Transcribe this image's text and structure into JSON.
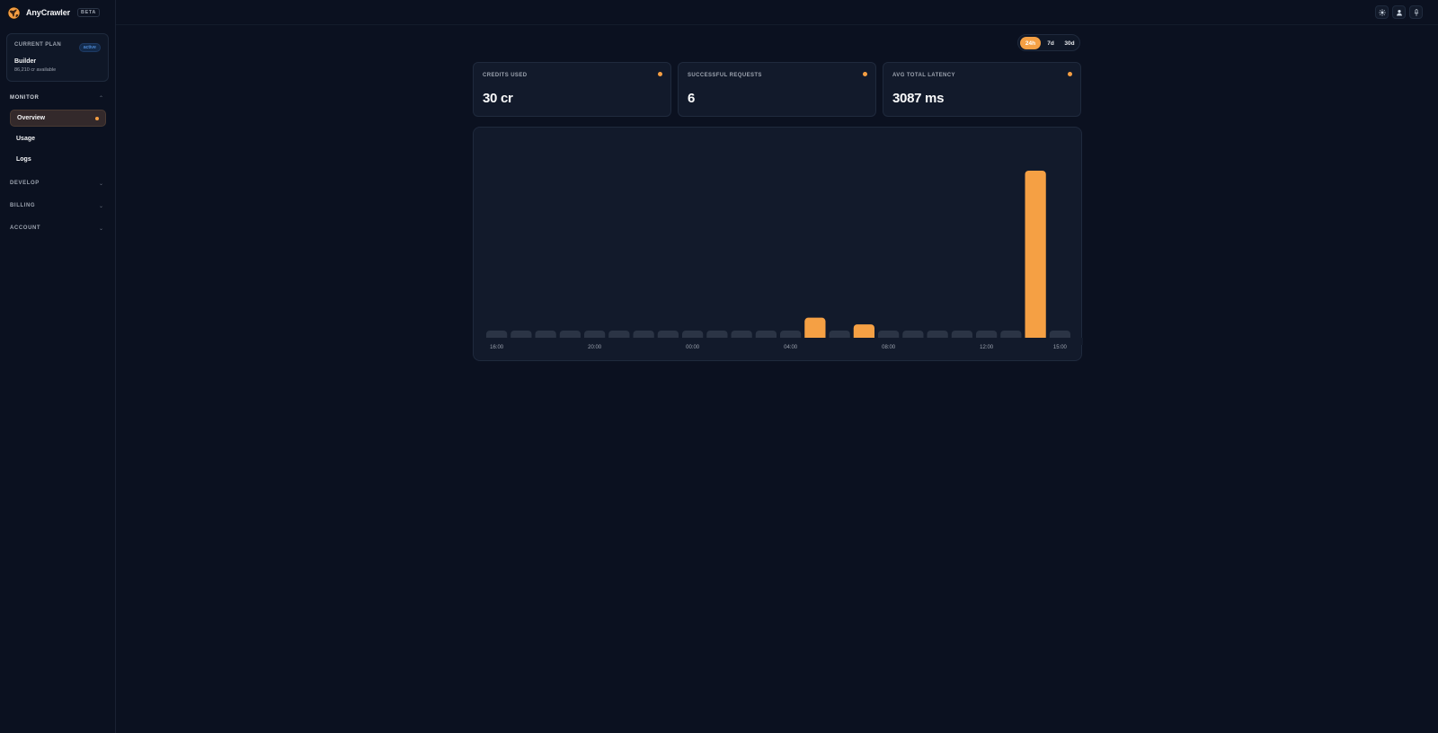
{
  "brand": {
    "name": "AnyCrawler",
    "badge": "BETA"
  },
  "plan": {
    "label": "CURRENT PLAN",
    "status": "active",
    "name": "Builder",
    "credits": "86,210 cr available"
  },
  "nav": {
    "monitor": {
      "label": "MONITOR",
      "items": [
        "Overview",
        "Usage",
        "Logs"
      ],
      "active": "Overview"
    },
    "develop": {
      "label": "DEVELOP"
    },
    "billing": {
      "label": "BILLING"
    },
    "account": {
      "label": "ACCOUNT"
    }
  },
  "header": {
    "icons": [
      "theme-icon",
      "user-icon",
      "pin-icon"
    ]
  },
  "range": {
    "options": [
      "24h",
      "7d",
      "30d"
    ],
    "selected": "24h"
  },
  "stats": [
    {
      "label": "CREDITS USED",
      "value": "30 cr"
    },
    {
      "label": "SUCCESSFUL REQUESTS",
      "value": "6"
    },
    {
      "label": "AVG TOTAL LATENCY",
      "value": "3087 ms"
    }
  ],
  "colors": {
    "accent": "#f5a044",
    "idle_bar": "#2b3445",
    "background": "#0b1120",
    "card": "#121a2b"
  },
  "chart_data": {
    "type": "bar",
    "tick_labels": [
      "16:00",
      "20:00",
      "00:00",
      "04:00",
      "08:00",
      "12:00",
      "15:00"
    ],
    "tick_positions": [
      0,
      4,
      8,
      12,
      16,
      20,
      23
    ],
    "values": [
      0,
      0,
      0,
      0,
      0,
      0,
      0,
      0,
      0,
      0,
      0,
      0,
      0,
      3,
      0,
      2,
      0,
      0,
      0,
      0,
      0,
      0,
      25,
      0
    ],
    "ylim": [
      0,
      25
    ],
    "grid": false,
    "title": "",
    "xlabel": "",
    "ylabel": ""
  }
}
